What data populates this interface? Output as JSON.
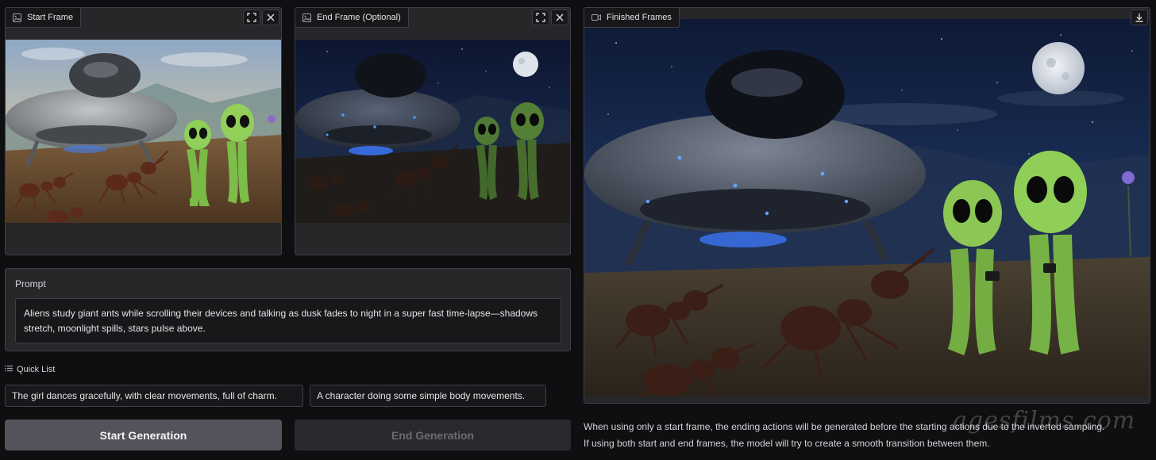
{
  "start_frame": {
    "label": "Start Frame",
    "icons": [
      "image-icon",
      "fullscreen-icon",
      "close-icon"
    ]
  },
  "end_frame": {
    "label": "End Frame (Optional)",
    "icons": [
      "image-icon",
      "fullscreen-icon",
      "close-icon"
    ]
  },
  "finished_frames": {
    "label": "Finished Frames",
    "icons": [
      "video-icon",
      "download-icon"
    ]
  },
  "prompt": {
    "label": "Prompt",
    "value": "Aliens study giant ants while scrolling their devices and talking as dusk fades to night in a super fast time-lapse—shadows stretch, moonlight spills, stars pulse above."
  },
  "quick_list": {
    "label": "Quick List",
    "items": [
      "The girl dances gracefully, with clear movements, full of charm.",
      "A character doing some simple body movements."
    ]
  },
  "buttons": {
    "start": "Start Generation",
    "end": "End Generation"
  },
  "info": {
    "line1": "When using only a start frame, the ending actions will be generated before the starting actions due to the inverted sampling.",
    "line2": "If using both start and end frames, the model will try to create a smooth transition between them."
  },
  "watermark": "agesfilms.com",
  "colors": {
    "background": "#0f0f11",
    "panel": "#27272a",
    "border": "#3f3f46",
    "start_button": "#53535c",
    "end_button_disabled": "#2a2a2e"
  }
}
